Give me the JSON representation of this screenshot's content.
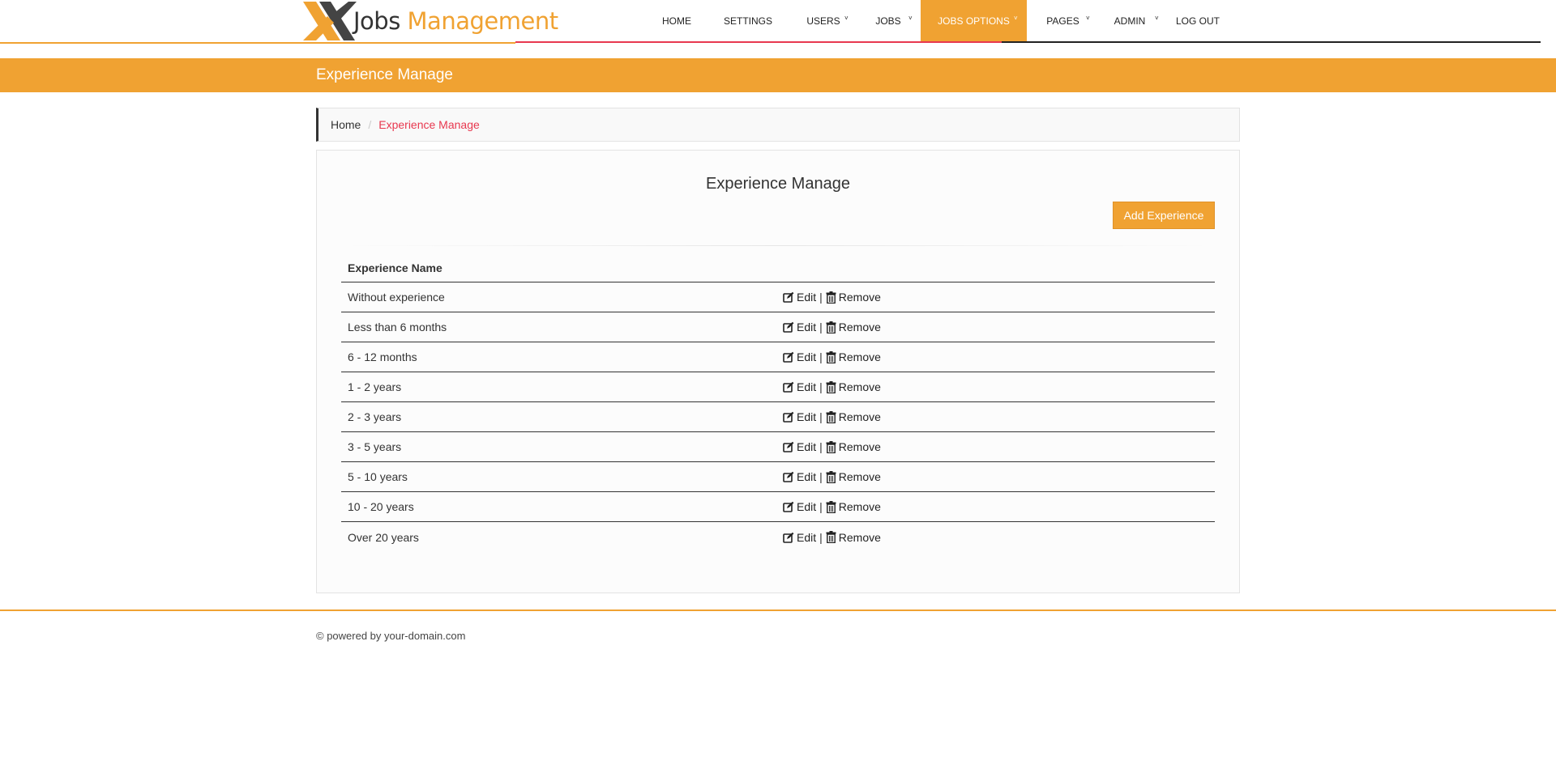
{
  "brand": {
    "part1": "Jobs",
    "part2": "Management"
  },
  "nav": [
    {
      "label": "HOME",
      "dropdown": false,
      "active": false
    },
    {
      "label": "SETTINGS",
      "dropdown": false,
      "active": false
    },
    {
      "label": "USERS",
      "dropdown": true,
      "active": false
    },
    {
      "label": "JOBS",
      "dropdown": true,
      "active": false
    },
    {
      "label": "JOBS OPTIONS",
      "dropdown": true,
      "active": true
    },
    {
      "label": "PAGES",
      "dropdown": true,
      "active": false
    },
    {
      "label": "ADMIN",
      "dropdown": true,
      "active": false
    },
    {
      "label": "LOG OUT",
      "dropdown": false,
      "active": false
    }
  ],
  "page_title": "Experience Manage",
  "breadcrumb": {
    "home": "Home",
    "separator": "/",
    "current": "Experience Manage"
  },
  "panel": {
    "title": "Experience Manage",
    "add_button": "Add Experience",
    "column_header": "Experience Name",
    "edit_label": "Edit",
    "remove_label": "Remove",
    "separator": "|",
    "rows": [
      "Without experience",
      "Less than 6 months",
      "6 - 12 months",
      "1 - 2 years",
      "2 - 3 years",
      "3 - 5 years",
      "5 - 10 years",
      "10 - 20 years",
      "Over 20 years"
    ]
  },
  "footer": {
    "text": "© powered by your-domain.com"
  },
  "colors": {
    "accent": "#f0a232",
    "highlight": "#e8384f",
    "dark": "#333333"
  },
  "icons": {
    "edit": "edit-square-icon",
    "remove": "trash-icon",
    "dropdown": "chevron-down-icon"
  }
}
